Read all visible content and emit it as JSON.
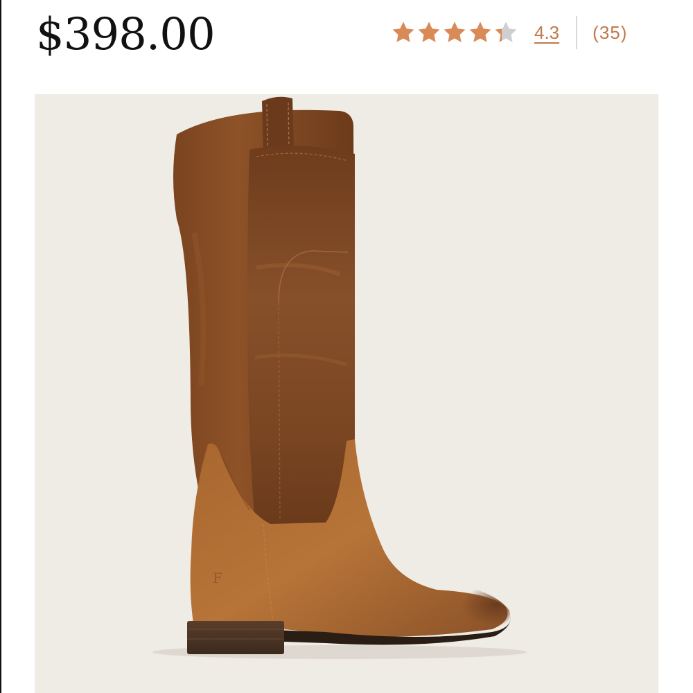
{
  "product": {
    "price": "$398.00",
    "rating": {
      "value": 4.3,
      "max": 5,
      "value_label": "4.3",
      "review_count_label": "(35)",
      "star_fill_color": "#d98a57",
      "star_empty_color": "#cfcfcf"
    },
    "image": {
      "alt": "tall cognac leather riding boot",
      "background_color": "#efebe5"
    }
  }
}
